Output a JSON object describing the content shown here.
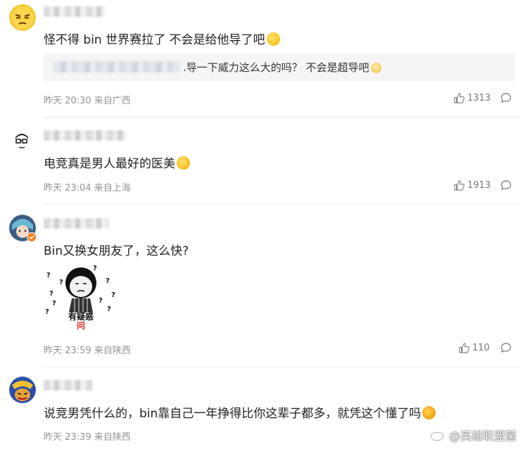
{
  "comments": [
    {
      "name_first_char": "",
      "text": "怪不得 bin 世界赛拉了 不会是给他导了吧",
      "emoji": "smirk-emoji",
      "quote": {
        "text": ".导一下威力这么大的吗？ 不会是超导吧",
        "emoji": "cat-emoji"
      },
      "meta": "昨天 20:30 来自广西",
      "likes": "1313"
    },
    {
      "name_first_char": "",
      "text": "电竞真是男人最好的医美",
      "emoji": "yum-emoji",
      "meta": "昨天 23:04 来自上海",
      "likes": "1913"
    },
    {
      "name_first_char": "",
      "text": "Bin又换女朋友了，这么快?",
      "meme": {
        "caption_line1": "有疑惑",
        "caption_line2": "问"
      },
      "meta": "昨天 23:59 来自陕西",
      "likes": "110"
    },
    {
      "name_first_char": "",
      "text": "说竞男凭什么的，bin靠自己一年挣得比你这辈子都多，就凭这个懂了吗",
      "emoji": "laugh-emoji",
      "meta": "昨天 23:39 来自陕西",
      "likes": ""
    }
  ],
  "watermark": {
    "text": "@英雄联盟菌"
  },
  "colors": {
    "text": "#222222",
    "meta": "#939393",
    "divider": "#ececec",
    "quote_bg": "#f5f5f5"
  }
}
